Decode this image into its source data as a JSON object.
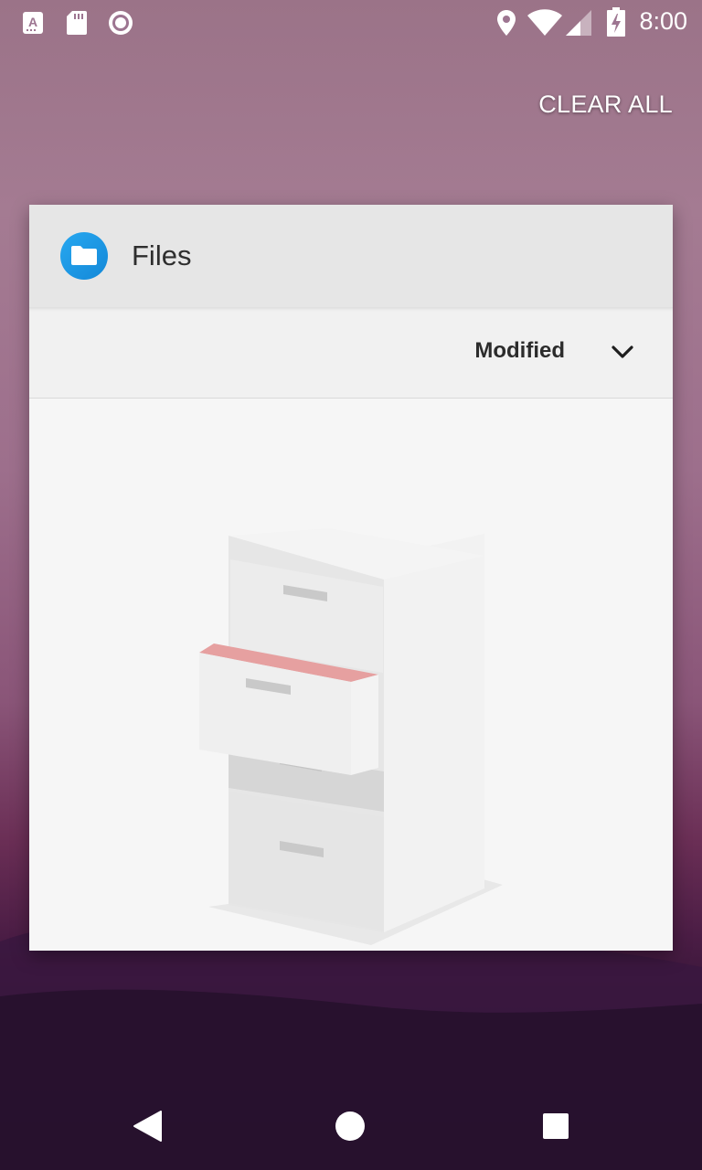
{
  "status_bar": {
    "time": "8:00",
    "icons": [
      "a-notification-icon",
      "sd-card-icon",
      "record-icon",
      "location-icon",
      "wifi-icon",
      "cell-signal-icon",
      "battery-charging-icon"
    ]
  },
  "recents": {
    "clear_all_label": "CLEAR ALL"
  },
  "task_card": {
    "app_name": "Files",
    "app_icon": "folder-icon",
    "accent_color": "#1e9be8",
    "sort": {
      "label": "Modified",
      "icon": "chevron-down-icon"
    },
    "illustration": "file-cabinet-illustration"
  },
  "nav_bar": {
    "buttons": [
      "back-icon",
      "home-icon",
      "overview-icon"
    ]
  }
}
